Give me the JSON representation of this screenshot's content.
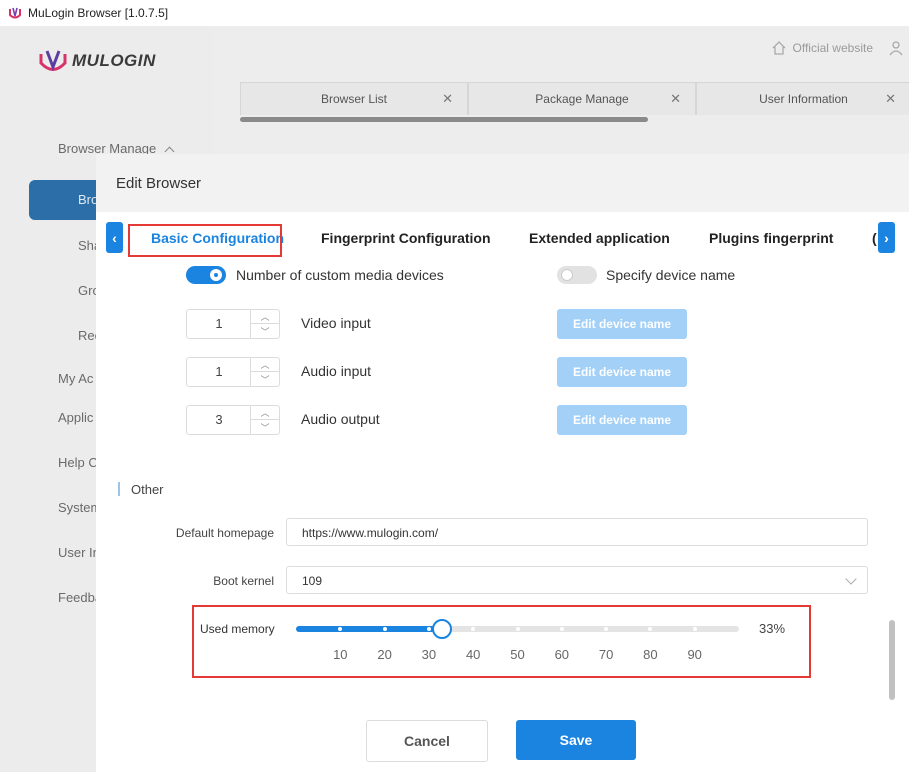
{
  "window": {
    "title": "MuLogin Browser  [1.0.7.5]"
  },
  "header": {
    "logo_text": "MULOGIN",
    "official_website": "Official website"
  },
  "sidebar": {
    "browser_manage": "Browser Manage",
    "items": [
      "Bro",
      "Sha",
      "Gro",
      "Rec"
    ],
    "sections": [
      "My Ac",
      "Applic",
      "Help C",
      "System",
      "User In",
      "Feedba"
    ]
  },
  "bg_tabs": [
    "Browser List",
    "Package Manage",
    "User Information"
  ],
  "modal": {
    "title": "Edit Browser",
    "tabs": [
      "Basic Configuration",
      "Fingerprint Configuration",
      "Extended application",
      "Plugins fingerprint",
      "("
    ],
    "media": {
      "custom_media_label": "Number of custom media devices",
      "specify_device_label": "Specify device name",
      "rows": [
        {
          "value": "1",
          "label": "Video input",
          "button": "Edit device name"
        },
        {
          "value": "1",
          "label": "Audio input",
          "button": "Edit device name"
        },
        {
          "value": "3",
          "label": "Audio output",
          "button": "Edit device name"
        }
      ]
    },
    "other": {
      "section_title": "Other",
      "homepage_label": "Default homepage",
      "homepage_value": "https://www.mulogin.com/",
      "kernel_label": "Boot kernel",
      "kernel_value": "109",
      "memory_label": "Used memory",
      "memory_value": 33,
      "memory_percent_text": "33%",
      "memory_ticks": [
        "10",
        "20",
        "30",
        "40",
        "50",
        "60",
        "70",
        "80",
        "90"
      ]
    },
    "buttons": {
      "cancel": "Cancel",
      "save": "Save"
    }
  },
  "colors": {
    "accent": "#1a84e0",
    "highlight": "#e53935",
    "disabled_button": "#a3d0f7"
  }
}
